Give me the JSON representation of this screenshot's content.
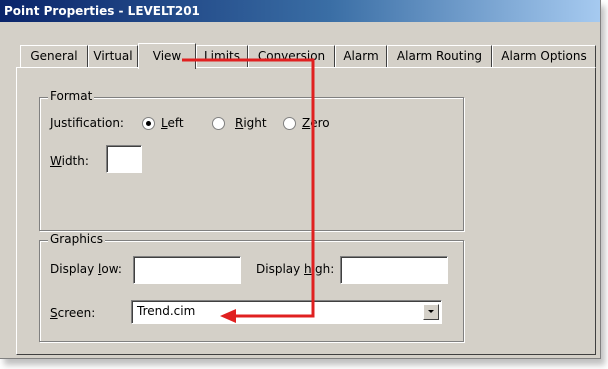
{
  "window": {
    "title": "Point Properties - LEVELT201"
  },
  "tabs": [
    {
      "label": "General"
    },
    {
      "label": "Virtual"
    },
    {
      "label": "View",
      "active": true
    },
    {
      "label": "Limits"
    },
    {
      "label": "Conversion"
    },
    {
      "label": "Alarm"
    },
    {
      "label": "Alarm Routing"
    },
    {
      "label": "Alarm Options"
    }
  ],
  "format": {
    "group_label": "Format",
    "justification_label": "Justification:",
    "options": [
      {
        "label": "Left",
        "mnemonic": "L",
        "rest": "eft",
        "selected": true
      },
      {
        "label": "Right",
        "mnemonic": "R",
        "rest": "ight",
        "selected": false
      },
      {
        "label": "Zero",
        "mnemonic": "Z",
        "rest": "ero",
        "selected": false
      }
    ],
    "width": {
      "mnemonic": "W",
      "rest": "idth:",
      "value": ""
    }
  },
  "graphics": {
    "group_label": "Graphics",
    "display_low": {
      "prefix": "Display ",
      "mnemonic": "l",
      "rest": "ow:",
      "value": ""
    },
    "display_high": {
      "prefix": "Display ",
      "mnemonic": "h",
      "rest": "igh:",
      "value": ""
    },
    "screen": {
      "mnemonic": "S",
      "rest": "creen:",
      "value": "Trend.cim"
    }
  },
  "annotation": {
    "arrow_color": "#e02020"
  }
}
